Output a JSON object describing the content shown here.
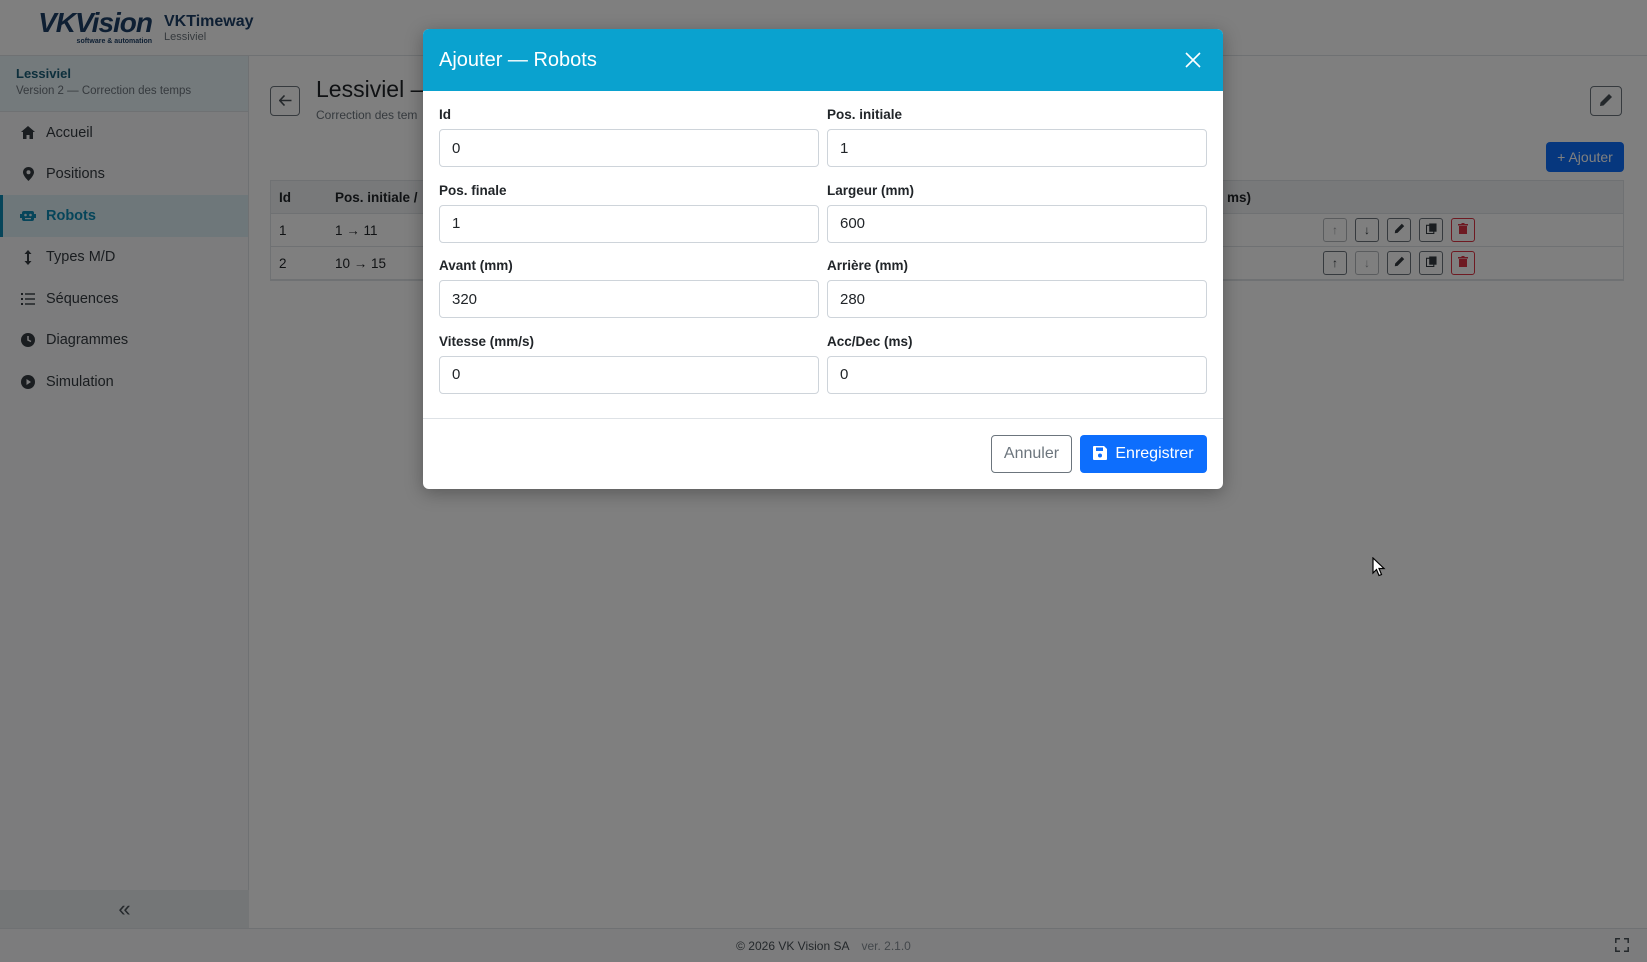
{
  "header": {
    "logo_text": "VKVision",
    "logo_sub": "software & automation",
    "app_name": "VKTimeway",
    "project": "Lessiviel"
  },
  "sidebar": {
    "project_name": "Lessiviel",
    "project_version": "Version 2 — Correction des temps",
    "items": [
      {
        "label": "Accueil",
        "icon": "home-icon"
      },
      {
        "label": "Positions",
        "icon": "map-pin-icon"
      },
      {
        "label": "Robots",
        "icon": "robot-icon",
        "active": true
      },
      {
        "label": "Types M/D",
        "icon": "updown-arrow-icon"
      },
      {
        "label": "Séquences",
        "icon": "list-icon"
      },
      {
        "label": "Diagrammes",
        "icon": "clock-icon"
      },
      {
        "label": "Simulation",
        "icon": "play-circle-icon"
      }
    ],
    "collapse_glyph": "«"
  },
  "main": {
    "title": "Lessiviel –",
    "subtitle": "Correction des tem",
    "add_label": "+ Ajouter",
    "columns": {
      "id": "Id",
      "pos": "Pos. initiale /",
      "ms": "ms)"
    },
    "rows": [
      {
        "id": "1",
        "pos": "1 → 11"
      },
      {
        "id": "2",
        "pos": "10 → 15"
      }
    ]
  },
  "modal": {
    "title": "Ajouter — Robots",
    "close": "×",
    "fields": [
      {
        "label": "Id",
        "value": "0"
      },
      {
        "label": "Pos. initiale",
        "value": "1"
      },
      {
        "label": "Pos. finale",
        "value": "1"
      },
      {
        "label": "Largeur (mm)",
        "value": "600"
      },
      {
        "label": "Avant (mm)",
        "value": "320"
      },
      {
        "label": "Arrière (mm)",
        "value": "280"
      },
      {
        "label": "Vitesse (mm/s)",
        "value": "0"
      },
      {
        "label": "Acc/Dec (ms)",
        "value": "0"
      }
    ],
    "cancel_label": "Annuler",
    "save_label": "Enregistrer"
  },
  "footer": {
    "copyright": "© 2026 VK Vision SA",
    "version": "ver. 2.1.0"
  },
  "colors": {
    "accent": "#0aa2cf",
    "primary": "#0d6efd",
    "danger": "#dc3545",
    "brand": "#1c3f66"
  }
}
